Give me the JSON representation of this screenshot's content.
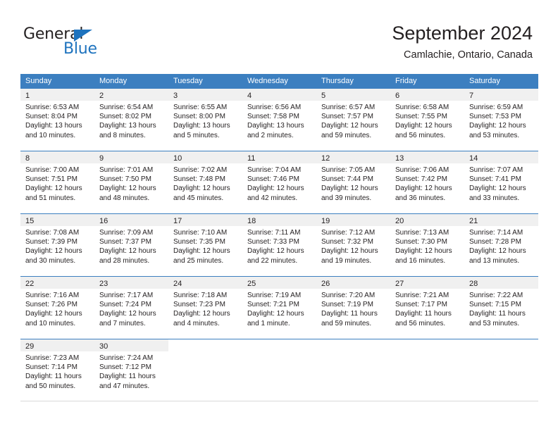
{
  "brand": {
    "name_part1": "General",
    "name_part2": "Blue",
    "accent_color": "#1e73be"
  },
  "header": {
    "title": "September 2024",
    "subtitle": "Camlachie, Ontario, Canada"
  },
  "calendar": {
    "header_color": "#3c7fc0",
    "weekdays": [
      "Sunday",
      "Monday",
      "Tuesday",
      "Wednesday",
      "Thursday",
      "Friday",
      "Saturday"
    ],
    "weeks": [
      [
        {
          "day": "1",
          "sunrise": "Sunrise: 6:53 AM",
          "sunset": "Sunset: 8:04 PM",
          "daylight": "Daylight: 13 hours and 10 minutes."
        },
        {
          "day": "2",
          "sunrise": "Sunrise: 6:54 AM",
          "sunset": "Sunset: 8:02 PM",
          "daylight": "Daylight: 13 hours and 8 minutes."
        },
        {
          "day": "3",
          "sunrise": "Sunrise: 6:55 AM",
          "sunset": "Sunset: 8:00 PM",
          "daylight": "Daylight: 13 hours and 5 minutes."
        },
        {
          "day": "4",
          "sunrise": "Sunrise: 6:56 AM",
          "sunset": "Sunset: 7:58 PM",
          "daylight": "Daylight: 13 hours and 2 minutes."
        },
        {
          "day": "5",
          "sunrise": "Sunrise: 6:57 AM",
          "sunset": "Sunset: 7:57 PM",
          "daylight": "Daylight: 12 hours and 59 minutes."
        },
        {
          "day": "6",
          "sunrise": "Sunrise: 6:58 AM",
          "sunset": "Sunset: 7:55 PM",
          "daylight": "Daylight: 12 hours and 56 minutes."
        },
        {
          "day": "7",
          "sunrise": "Sunrise: 6:59 AM",
          "sunset": "Sunset: 7:53 PM",
          "daylight": "Daylight: 12 hours and 53 minutes."
        }
      ],
      [
        {
          "day": "8",
          "sunrise": "Sunrise: 7:00 AM",
          "sunset": "Sunset: 7:51 PM",
          "daylight": "Daylight: 12 hours and 51 minutes."
        },
        {
          "day": "9",
          "sunrise": "Sunrise: 7:01 AM",
          "sunset": "Sunset: 7:50 PM",
          "daylight": "Daylight: 12 hours and 48 minutes."
        },
        {
          "day": "10",
          "sunrise": "Sunrise: 7:02 AM",
          "sunset": "Sunset: 7:48 PM",
          "daylight": "Daylight: 12 hours and 45 minutes."
        },
        {
          "day": "11",
          "sunrise": "Sunrise: 7:04 AM",
          "sunset": "Sunset: 7:46 PM",
          "daylight": "Daylight: 12 hours and 42 minutes."
        },
        {
          "day": "12",
          "sunrise": "Sunrise: 7:05 AM",
          "sunset": "Sunset: 7:44 PM",
          "daylight": "Daylight: 12 hours and 39 minutes."
        },
        {
          "day": "13",
          "sunrise": "Sunrise: 7:06 AM",
          "sunset": "Sunset: 7:42 PM",
          "daylight": "Daylight: 12 hours and 36 minutes."
        },
        {
          "day": "14",
          "sunrise": "Sunrise: 7:07 AM",
          "sunset": "Sunset: 7:41 PM",
          "daylight": "Daylight: 12 hours and 33 minutes."
        }
      ],
      [
        {
          "day": "15",
          "sunrise": "Sunrise: 7:08 AM",
          "sunset": "Sunset: 7:39 PM",
          "daylight": "Daylight: 12 hours and 30 minutes."
        },
        {
          "day": "16",
          "sunrise": "Sunrise: 7:09 AM",
          "sunset": "Sunset: 7:37 PM",
          "daylight": "Daylight: 12 hours and 28 minutes."
        },
        {
          "day": "17",
          "sunrise": "Sunrise: 7:10 AM",
          "sunset": "Sunset: 7:35 PM",
          "daylight": "Daylight: 12 hours and 25 minutes."
        },
        {
          "day": "18",
          "sunrise": "Sunrise: 7:11 AM",
          "sunset": "Sunset: 7:33 PM",
          "daylight": "Daylight: 12 hours and 22 minutes."
        },
        {
          "day": "19",
          "sunrise": "Sunrise: 7:12 AM",
          "sunset": "Sunset: 7:32 PM",
          "daylight": "Daylight: 12 hours and 19 minutes."
        },
        {
          "day": "20",
          "sunrise": "Sunrise: 7:13 AM",
          "sunset": "Sunset: 7:30 PM",
          "daylight": "Daylight: 12 hours and 16 minutes."
        },
        {
          "day": "21",
          "sunrise": "Sunrise: 7:14 AM",
          "sunset": "Sunset: 7:28 PM",
          "daylight": "Daylight: 12 hours and 13 minutes."
        }
      ],
      [
        {
          "day": "22",
          "sunrise": "Sunrise: 7:16 AM",
          "sunset": "Sunset: 7:26 PM",
          "daylight": "Daylight: 12 hours and 10 minutes."
        },
        {
          "day": "23",
          "sunrise": "Sunrise: 7:17 AM",
          "sunset": "Sunset: 7:24 PM",
          "daylight": "Daylight: 12 hours and 7 minutes."
        },
        {
          "day": "24",
          "sunrise": "Sunrise: 7:18 AM",
          "sunset": "Sunset: 7:23 PM",
          "daylight": "Daylight: 12 hours and 4 minutes."
        },
        {
          "day": "25",
          "sunrise": "Sunrise: 7:19 AM",
          "sunset": "Sunset: 7:21 PM",
          "daylight": "Daylight: 12 hours and 1 minute."
        },
        {
          "day": "26",
          "sunrise": "Sunrise: 7:20 AM",
          "sunset": "Sunset: 7:19 PM",
          "daylight": "Daylight: 11 hours and 59 minutes."
        },
        {
          "day": "27",
          "sunrise": "Sunrise: 7:21 AM",
          "sunset": "Sunset: 7:17 PM",
          "daylight": "Daylight: 11 hours and 56 minutes."
        },
        {
          "day": "28",
          "sunrise": "Sunrise: 7:22 AM",
          "sunset": "Sunset: 7:15 PM",
          "daylight": "Daylight: 11 hours and 53 minutes."
        }
      ],
      [
        {
          "day": "29",
          "sunrise": "Sunrise: 7:23 AM",
          "sunset": "Sunset: 7:14 PM",
          "daylight": "Daylight: 11 hours and 50 minutes."
        },
        {
          "day": "30",
          "sunrise": "Sunrise: 7:24 AM",
          "sunset": "Sunset: 7:12 PM",
          "daylight": "Daylight: 11 hours and 47 minutes."
        },
        {
          "day": "",
          "sunrise": "",
          "sunset": "",
          "daylight": ""
        },
        {
          "day": "",
          "sunrise": "",
          "sunset": "",
          "daylight": ""
        },
        {
          "day": "",
          "sunrise": "",
          "sunset": "",
          "daylight": ""
        },
        {
          "day": "",
          "sunrise": "",
          "sunset": "",
          "daylight": ""
        },
        {
          "day": "",
          "sunrise": "",
          "sunset": "",
          "daylight": ""
        }
      ]
    ]
  }
}
